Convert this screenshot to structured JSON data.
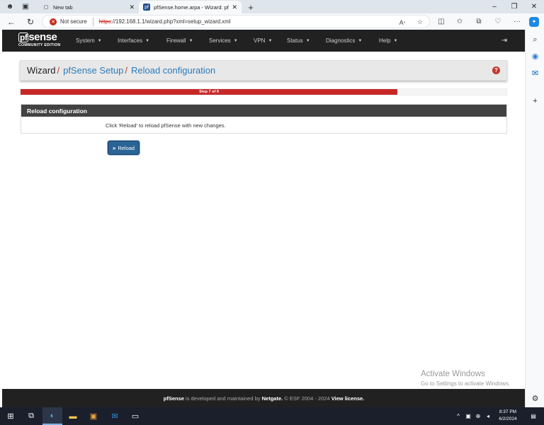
{
  "browser": {
    "tabs": [
      {
        "label": "New tab"
      },
      {
        "label": "pfSense.home.arpa - Wizard: pfS"
      }
    ],
    "address": {
      "security_label": "Not secure",
      "url_scheme": "https",
      "url_rest": "://192.168.1.1/wizard.php?xml=setup_wizard.xml"
    }
  },
  "navbar": {
    "logo_main": "pfsense",
    "logo_sub": "COMMUNITY EDITION",
    "menus": [
      "System",
      "Interfaces",
      "Firewall",
      "Services",
      "VPN",
      "Status",
      "Diagnostics",
      "Help"
    ]
  },
  "breadcrumb": {
    "items": [
      "Wizard",
      "pfSense Setup",
      "Reload configuration"
    ]
  },
  "progress": {
    "label": "Step 7 of 9",
    "fraction": 0.776
  },
  "panel": {
    "title": "Reload configuration",
    "body": "Click 'Reload' to reload pfSense with new changes."
  },
  "reload_button": {
    "label": "Reload"
  },
  "watermark": {
    "line1": "Activate Windows",
    "line2": "Go to Settings to activate Windows."
  },
  "footer": {
    "brand": "pfSense",
    "text1": " is developed and maintained by ",
    "company": "Netgate.",
    "text2": " © ESF 2004 - 2024 ",
    "license": "View license."
  },
  "taskbar": {
    "time": "8:37 PM",
    "date": "6/2/2024"
  },
  "colors": {
    "accent_red": "#c62828",
    "link_blue": "#2e7bb8",
    "navbar_bg": "#212121",
    "button_blue": "#2a6496"
  }
}
